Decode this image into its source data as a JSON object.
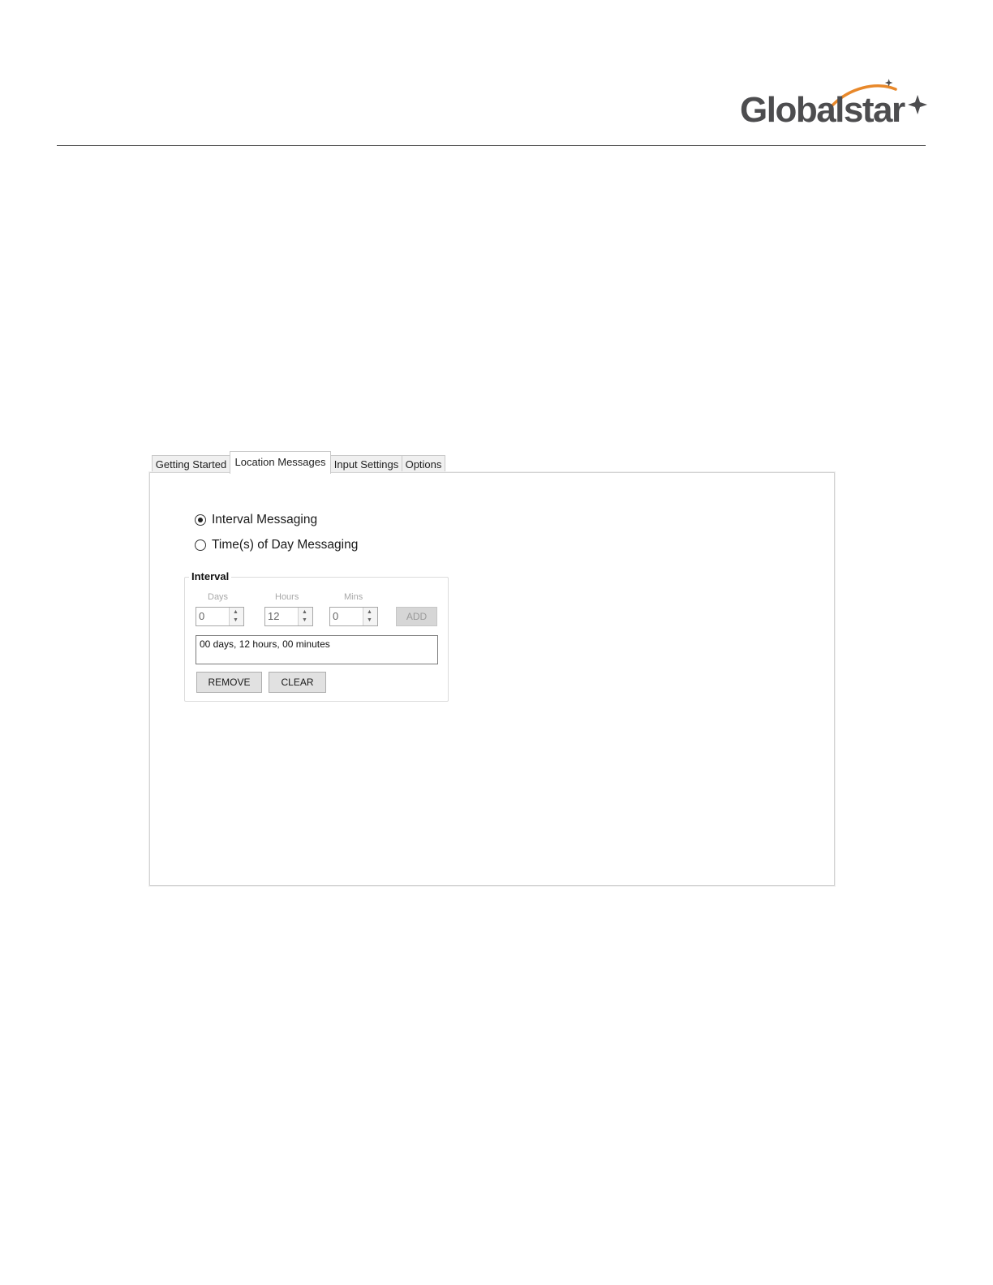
{
  "header": {
    "logo_text": "Globalstar",
    "logo_colors": {
      "text": "#4d4d4f",
      "swoosh": "#e8882a"
    }
  },
  "tabs": [
    {
      "label": "Getting Started",
      "active": false
    },
    {
      "label": "Location Messages",
      "active": true
    },
    {
      "label": "Input Settings",
      "active": false
    },
    {
      "label": "Options",
      "active": false
    }
  ],
  "messaging_mode": {
    "options": [
      {
        "label": "Interval Messaging",
        "selected": true
      },
      {
        "label": "Time(s) of Day Messaging",
        "selected": false
      }
    ]
  },
  "interval": {
    "legend": "Interval",
    "days": {
      "label": "Days",
      "value": "0"
    },
    "hours": {
      "label": "Hours",
      "value": "12"
    },
    "mins": {
      "label": "Mins",
      "value": "0"
    },
    "add_label": "ADD",
    "list_items": [
      "00 days, 12 hours, 00 minutes"
    ],
    "remove_label": "REMOVE",
    "clear_label": "CLEAR"
  }
}
